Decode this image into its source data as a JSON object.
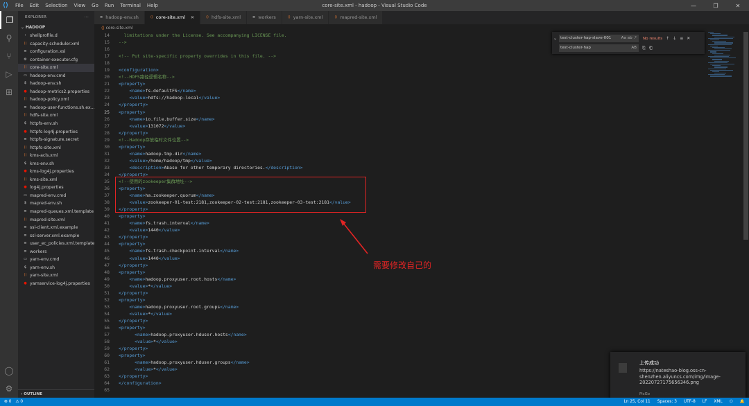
{
  "titlebar": {
    "menu": [
      "File",
      "Edit",
      "Selection",
      "View",
      "Go",
      "Run",
      "Terminal",
      "Help"
    ],
    "title": "core-site.xml - hadoop - Visual Studio Code"
  },
  "sidebar": {
    "header": "EXPLORER",
    "folder": "HADOOP",
    "files": [
      {
        "name": "shellprofile.d",
        "icon": "folder-icon",
        "color": "#cccccc"
      },
      {
        "name": "capacity-scheduler.xml",
        "icon": "xml-icon",
        "color": "#e37933"
      },
      {
        "name": "configuration.xsl",
        "icon": "xsl-icon",
        "color": "#cccccc"
      },
      {
        "name": "container-executor.cfg",
        "icon": "gear-icon",
        "color": "#cccccc"
      },
      {
        "name": "core-site.xml",
        "icon": "xml-icon",
        "color": "#e37933"
      },
      {
        "name": "hadoop-env.cmd",
        "icon": "cmd-icon",
        "color": "#cccccc"
      },
      {
        "name": "hadoop-env.sh",
        "icon": "sh-icon",
        "color": "#cccccc"
      },
      {
        "name": "hadoop-metrics2.properties",
        "icon": "properties-icon",
        "color": "#e51400"
      },
      {
        "name": "hadoop-policy.xml",
        "icon": "xml-icon",
        "color": "#e37933"
      },
      {
        "name": "hadoop-user-functions.sh.ex...",
        "icon": "file-icon",
        "color": "#cccccc"
      },
      {
        "name": "hdfs-site.xml",
        "icon": "xml-icon",
        "color": "#e37933"
      },
      {
        "name": "httpfs-env.sh",
        "icon": "sh-icon",
        "color": "#cccccc"
      },
      {
        "name": "httpfs-log4j.properties",
        "icon": "properties-icon",
        "color": "#e51400"
      },
      {
        "name": "httpfs-signature.secret",
        "icon": "file-icon",
        "color": "#cccccc"
      },
      {
        "name": "httpfs-site.xml",
        "icon": "xml-icon",
        "color": "#e37933"
      },
      {
        "name": "kms-acls.xml",
        "icon": "xml-icon",
        "color": "#e37933"
      },
      {
        "name": "kms-env.sh",
        "icon": "sh-icon",
        "color": "#cccccc"
      },
      {
        "name": "kms-log4j.properties",
        "icon": "properties-icon",
        "color": "#e51400"
      },
      {
        "name": "kms-site.xml",
        "icon": "xml-icon",
        "color": "#e37933"
      },
      {
        "name": "log4j.properties",
        "icon": "properties-icon",
        "color": "#e51400"
      },
      {
        "name": "mapred-env.cmd",
        "icon": "cmd-icon",
        "color": "#cccccc"
      },
      {
        "name": "mapred-env.sh",
        "icon": "sh-icon",
        "color": "#cccccc"
      },
      {
        "name": "mapred-queues.xml.template",
        "icon": "file-icon",
        "color": "#cccccc"
      },
      {
        "name": "mapred-site.xml",
        "icon": "xml-icon",
        "color": "#e37933"
      },
      {
        "name": "ssl-client.xml.example",
        "icon": "file-icon",
        "color": "#cccccc"
      },
      {
        "name": "ssl-server.xml.example",
        "icon": "file-icon",
        "color": "#cccccc"
      },
      {
        "name": "user_ec_policies.xml.template",
        "icon": "file-icon",
        "color": "#cccccc"
      },
      {
        "name": "workers",
        "icon": "file-icon",
        "color": "#cccccc"
      },
      {
        "name": "yarn-env.cmd",
        "icon": "cmd-icon",
        "color": "#cccccc"
      },
      {
        "name": "yarn-env.sh",
        "icon": "sh-icon",
        "color": "#cccccc"
      },
      {
        "name": "yarn-site.xml",
        "icon": "xml-icon",
        "color": "#e37933"
      },
      {
        "name": "yarnservice-log4j.properties",
        "icon": "properties-icon",
        "color": "#e51400"
      }
    ],
    "selected_index": 4,
    "outline": "OUTLINE"
  },
  "tabs": [
    {
      "label": "hadoop-env.sh",
      "active": false
    },
    {
      "label": "core-site.xml",
      "active": true
    },
    {
      "label": "hdfs-site.xml",
      "active": false
    },
    {
      "label": "workers",
      "active": false
    },
    {
      "label": "yarn-site.xml",
      "active": false
    },
    {
      "label": "mapred-site.xml",
      "active": false
    }
  ],
  "breadcrumb": "core-site.xml",
  "find": {
    "search_value": "test-cluster-hap-slave-001",
    "search_opts": "Aa  ab  .*",
    "result": "No results",
    "replace_value": "test-cluster-hap",
    "replace_opt": "AB"
  },
  "code": {
    "current_line": 25,
    "lines": [
      {
        "n": 14,
        "t": [
          [
            "c",
            "  limitations under the License. See accompanying LICENSE file."
          ]
        ]
      },
      {
        "n": 15,
        "t": [
          [
            "c",
            "-->"
          ]
        ]
      },
      {
        "n": 16,
        "t": []
      },
      {
        "n": 17,
        "t": [
          [
            "c",
            "<!-- Put site-specific property overrides in this file. -->"
          ]
        ]
      },
      {
        "n": 18,
        "t": []
      },
      {
        "n": 19,
        "t": [
          [
            "g",
            "<configuration>"
          ]
        ]
      },
      {
        "n": 20,
        "t": [
          [
            "c",
            "<!--HDFS路径逻辑名称-->"
          ]
        ]
      },
      {
        "n": 21,
        "t": [
          [
            "g",
            "<property>"
          ]
        ]
      },
      {
        "n": 22,
        "t": [
          [
            "s",
            "    "
          ],
          [
            "g",
            "<name>"
          ],
          [
            "s",
            "fs.defaultFS"
          ],
          [
            "g",
            "</name>"
          ]
        ]
      },
      {
        "n": 23,
        "t": [
          [
            "s",
            "    "
          ],
          [
            "g",
            "<value>"
          ],
          [
            "s",
            "hdfs://hadoop-local"
          ],
          [
            "g",
            "</value>"
          ]
        ]
      },
      {
        "n": 24,
        "t": [
          [
            "g",
            "</property>"
          ]
        ]
      },
      {
        "n": 25,
        "t": [
          [
            "g",
            "<property>"
          ]
        ]
      },
      {
        "n": 26,
        "t": [
          [
            "s",
            "    "
          ],
          [
            "g",
            "<name>"
          ],
          [
            "s",
            "io.file.buffer.size"
          ],
          [
            "g",
            "</name>"
          ]
        ]
      },
      {
        "n": 27,
        "t": [
          [
            "s",
            "    "
          ],
          [
            "g",
            "<value>"
          ],
          [
            "s",
            "131072"
          ],
          [
            "g",
            "</value>"
          ]
        ]
      },
      {
        "n": 28,
        "t": [
          [
            "g",
            "</property>"
          ]
        ]
      },
      {
        "n": 29,
        "t": [
          [
            "c",
            "<!--Hadoop存放临时文件位置-->"
          ]
        ]
      },
      {
        "n": 30,
        "t": [
          [
            "g",
            "<property>"
          ]
        ]
      },
      {
        "n": 31,
        "t": [
          [
            "s",
            "    "
          ],
          [
            "g",
            "<name>"
          ],
          [
            "s",
            "hadoop.tmp.dir"
          ],
          [
            "g",
            "</name>"
          ]
        ]
      },
      {
        "n": 32,
        "t": [
          [
            "s",
            "    "
          ],
          [
            "g",
            "<value>"
          ],
          [
            "s",
            "/home/hadoop/tmp"
          ],
          [
            "g",
            "</value>"
          ]
        ]
      },
      {
        "n": 33,
        "t": [
          [
            "s",
            "    "
          ],
          [
            "g",
            "<description>"
          ],
          [
            "s",
            "Abase for other temporary directories."
          ],
          [
            "g",
            "</description>"
          ]
        ]
      },
      {
        "n": 34,
        "t": [
          [
            "g",
            "</property>"
          ]
        ]
      },
      {
        "n": 35,
        "t": [
          [
            "c",
            "<!--使用的zookeeper集群地址-->"
          ]
        ]
      },
      {
        "n": 36,
        "t": [
          [
            "g",
            "<property>"
          ]
        ]
      },
      {
        "n": 37,
        "t": [
          [
            "s",
            "    "
          ],
          [
            "g",
            "<name>"
          ],
          [
            "s",
            "ha.zookeeper.quorum"
          ],
          [
            "g",
            "</name>"
          ]
        ]
      },
      {
        "n": 38,
        "t": [
          [
            "s",
            "    "
          ],
          [
            "g",
            "<value>"
          ],
          [
            "s",
            "zookeeper-01-test:2181,zookeeper-02-test:2181,zookeeper-03-test:2181"
          ],
          [
            "g",
            "</value>"
          ]
        ]
      },
      {
        "n": 39,
        "t": [
          [
            "g",
            "</property>"
          ]
        ]
      },
      {
        "n": 40,
        "t": [
          [
            "g",
            "<property>"
          ]
        ]
      },
      {
        "n": 41,
        "t": [
          [
            "s",
            "    "
          ],
          [
            "g",
            "<name>"
          ],
          [
            "s",
            "fs.trash.interval"
          ],
          [
            "g",
            "</name>"
          ]
        ]
      },
      {
        "n": 42,
        "t": [
          [
            "s",
            "    "
          ],
          [
            "g",
            "<value>"
          ],
          [
            "s",
            "1440"
          ],
          [
            "g",
            "</value>"
          ]
        ]
      },
      {
        "n": 43,
        "t": [
          [
            "g",
            "</property>"
          ]
        ]
      },
      {
        "n": 44,
        "t": [
          [
            "g",
            "<property>"
          ]
        ]
      },
      {
        "n": 45,
        "t": [
          [
            "s",
            "    "
          ],
          [
            "g",
            "<name>"
          ],
          [
            "s",
            "fs.trash.checkpoint.interval"
          ],
          [
            "g",
            "</name>"
          ]
        ]
      },
      {
        "n": 46,
        "t": [
          [
            "s",
            "    "
          ],
          [
            "g",
            "<value>"
          ],
          [
            "s",
            "1440"
          ],
          [
            "g",
            "</value>"
          ]
        ]
      },
      {
        "n": 47,
        "t": [
          [
            "g",
            "</property>"
          ]
        ]
      },
      {
        "n": 48,
        "t": [
          [
            "g",
            "<property>"
          ]
        ]
      },
      {
        "n": 49,
        "t": [
          [
            "s",
            "    "
          ],
          [
            "g",
            "<name>"
          ],
          [
            "s",
            "hadoop.proxyuser.root.hosts"
          ],
          [
            "g",
            "</name>"
          ]
        ]
      },
      {
        "n": 50,
        "t": [
          [
            "s",
            "    "
          ],
          [
            "g",
            "<value>"
          ],
          [
            "s",
            "*"
          ],
          [
            "g",
            "</value>"
          ]
        ]
      },
      {
        "n": 51,
        "t": [
          [
            "g",
            "</property>"
          ]
        ]
      },
      {
        "n": 52,
        "t": [
          [
            "g",
            "<property>"
          ]
        ]
      },
      {
        "n": 53,
        "t": [
          [
            "s",
            "    "
          ],
          [
            "g",
            "<name>"
          ],
          [
            "s",
            "hadoop.proxyuser.root.groups"
          ],
          [
            "g",
            "</name>"
          ]
        ]
      },
      {
        "n": 54,
        "t": [
          [
            "s",
            "    "
          ],
          [
            "g",
            "<value>"
          ],
          [
            "s",
            "*"
          ],
          [
            "g",
            "</value>"
          ]
        ]
      },
      {
        "n": 55,
        "t": [
          [
            "g",
            "</property>"
          ]
        ]
      },
      {
        "n": 56,
        "t": [
          [
            "g",
            "<property>"
          ]
        ]
      },
      {
        "n": 57,
        "t": [
          [
            "s",
            "      "
          ],
          [
            "g",
            "<name>"
          ],
          [
            "s",
            "hadoop.proxyuser.hduser.hosts"
          ],
          [
            "g",
            "</name>"
          ]
        ]
      },
      {
        "n": 58,
        "t": [
          [
            "s",
            "      "
          ],
          [
            "g",
            "<value>"
          ],
          [
            "s",
            "*"
          ],
          [
            "g",
            "</value>"
          ]
        ]
      },
      {
        "n": 59,
        "t": [
          [
            "g",
            "</property>"
          ]
        ]
      },
      {
        "n": 60,
        "t": [
          [
            "g",
            "<property>"
          ]
        ]
      },
      {
        "n": 61,
        "t": [
          [
            "s",
            "      "
          ],
          [
            "g",
            "<name>"
          ],
          [
            "s",
            "hadoop.proxyuser.hduser.groups"
          ],
          [
            "g",
            "</name>"
          ]
        ]
      },
      {
        "n": 62,
        "t": [
          [
            "s",
            "      "
          ],
          [
            "g",
            "<value>"
          ],
          [
            "s",
            "*"
          ],
          [
            "g",
            "</value>"
          ]
        ]
      },
      {
        "n": 63,
        "t": [
          [
            "g",
            "</property>"
          ]
        ]
      },
      {
        "n": 64,
        "t": [
          [
            "g",
            "</configuration>"
          ]
        ]
      },
      {
        "n": 65,
        "t": []
      }
    ]
  },
  "annotation": "需要修改自己的",
  "notification": {
    "title": "上传成功",
    "body": "https://nateshao-blog.oss-cn-shenzhen.aliyuncs.com/img/image-20220727175656346.png",
    "source": "PicGo"
  },
  "statusbar": {
    "left": [
      "⊗ 0",
      "⚠ 0"
    ],
    "right": [
      "Ln 25, Col 11",
      "Spaces: 3",
      "UTF-8",
      "LF",
      "XML",
      "⚇",
      "🔔"
    ]
  },
  "colors": {
    "accent": "#007acc",
    "highlight": "#e32424",
    "tag": "#569cd6",
    "comment": "#6a9955"
  }
}
